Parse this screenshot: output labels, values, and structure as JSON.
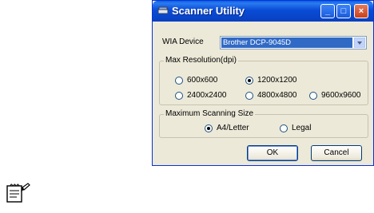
{
  "window": {
    "title": "Scanner Utility",
    "minimize": "_",
    "maximize": "□",
    "close": "×"
  },
  "wia": {
    "label": "WIA Device",
    "selected": "Brother DCP-9045D"
  },
  "resolution": {
    "group_title": "Max Resolution(dpi)",
    "options": [
      "600x600",
      "1200x1200",
      "2400x2400",
      "4800x4800",
      "9600x9600"
    ],
    "selected": "1200x1200"
  },
  "scan_size": {
    "group_title": "Maximum Scanning Size",
    "options": [
      "A4/Letter",
      "Legal"
    ],
    "selected": "A4/Letter"
  },
  "buttons": {
    "ok": "OK",
    "cancel": "Cancel"
  },
  "icons": {
    "title_icon": "scanner-icon",
    "note_icon": "note-pencil-icon"
  }
}
